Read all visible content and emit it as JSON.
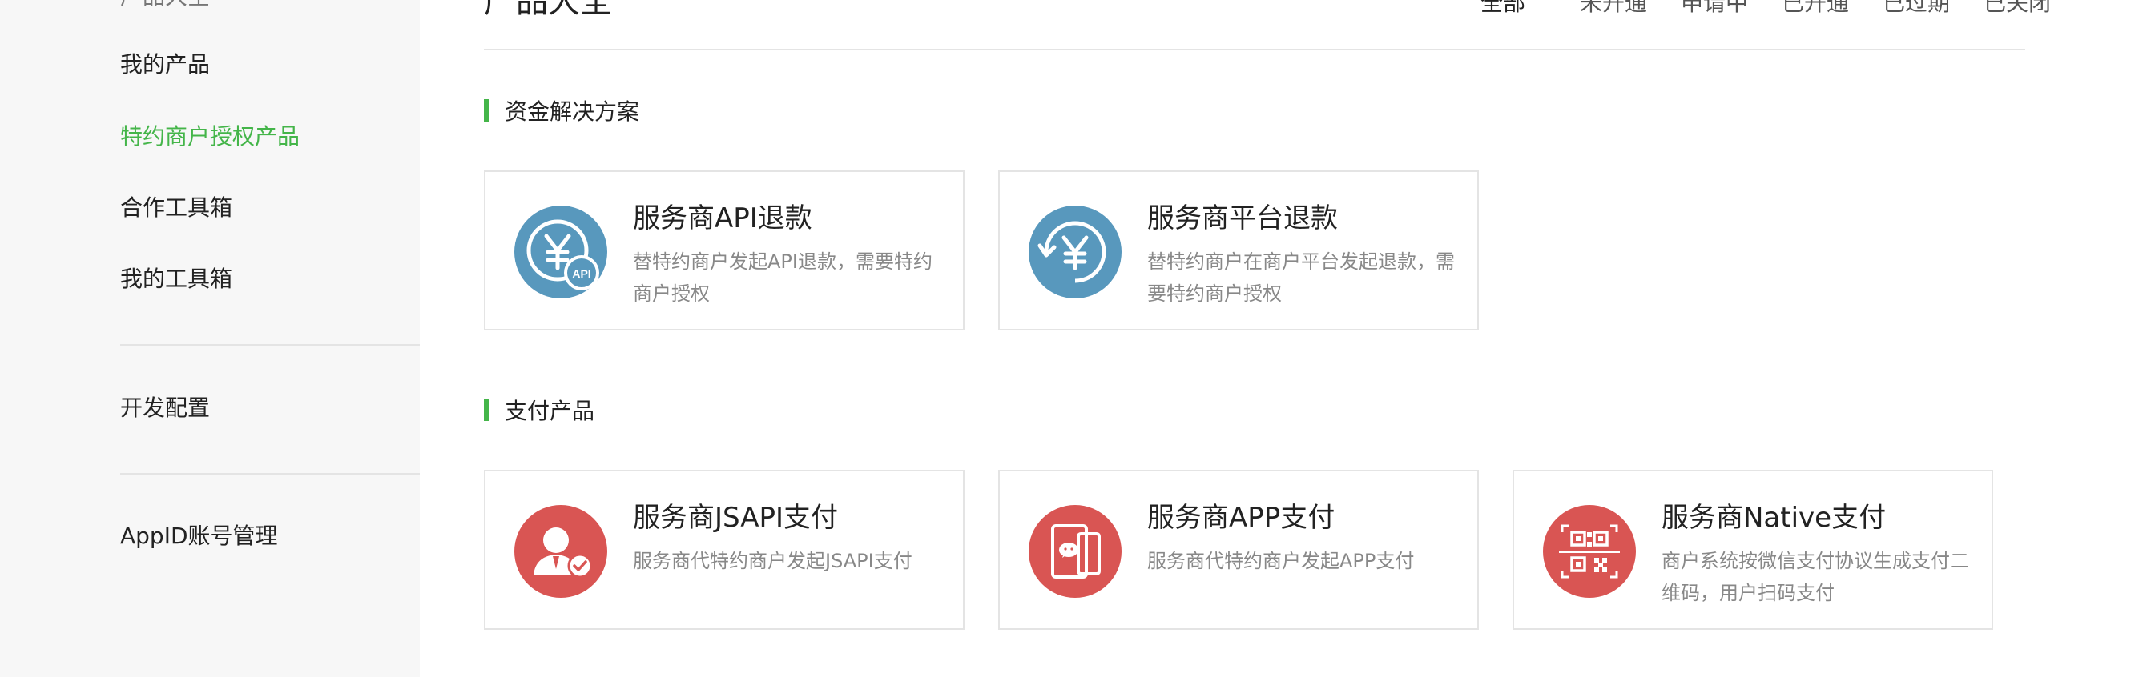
{
  "sidebar": {
    "cut_item": "产品大全",
    "items": [
      {
        "label": "我的产品",
        "active": false
      },
      {
        "label": "特约商户授权产品",
        "active": true
      },
      {
        "label": "合作工具箱",
        "active": false
      },
      {
        "label": "我的工具箱",
        "active": false
      }
    ],
    "dev_config": "开发配置",
    "appid_manage": "AppID账号管理"
  },
  "header": {
    "title": "产品大全",
    "filters": [
      "全部",
      "未开通",
      "申请中",
      "已开通",
      "已过期",
      "已关闭"
    ],
    "active_filter": "全部"
  },
  "sections": [
    {
      "title": "资金解决方案",
      "cards": [
        {
          "title": "服务商API退款",
          "desc": "替特约商户发起API退款，需要特约商户授权",
          "icon": "refund-api-icon",
          "color": "#5898bd"
        },
        {
          "title": "服务商平台退款",
          "desc": "替特约商户在商户平台发起退款，需要特约商户授权",
          "icon": "refund-platform-icon",
          "color": "#5898bd"
        }
      ]
    },
    {
      "title": "支付产品",
      "cards": [
        {
          "title": "服务商JSAPI支付",
          "desc": "服务商代特约商户发起JSAPI支付",
          "icon": "jsapi-pay-icon",
          "color": "#d95553"
        },
        {
          "title": "服务商APP支付",
          "desc": "服务商代特约商户发起APP支付",
          "icon": "app-pay-icon",
          "color": "#d95553"
        },
        {
          "title": "服务商Native支付",
          "desc": "商户系统按微信支付协议生成支付二维码，用户扫码支付",
          "icon": "qrcode-pay-icon",
          "color": "#d95553"
        }
      ]
    }
  ],
  "colors": {
    "accent": "#44b549",
    "refund_blue": "#5898bd",
    "pay_red": "#d95553"
  }
}
